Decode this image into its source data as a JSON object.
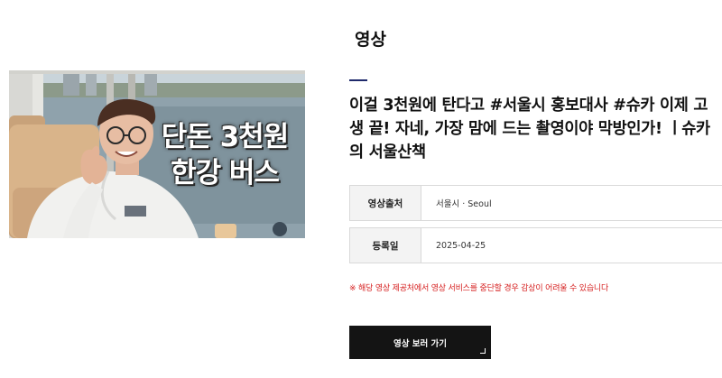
{
  "section": {
    "title": "영상"
  },
  "thumbnail": {
    "overlay_text_line1": "단돈 3천원",
    "overlay_text_line2": "한강 버스"
  },
  "video": {
    "title": "이걸 3천원에 탄다고 #서울시 홍보대사 #슈카 이제 고생 끝! 자네, 가장 맘에 드는 촬영이야 막방인가! ㅣ슈카의 서울산책"
  },
  "info": [
    {
      "label": "영상출처",
      "value": "서울시 · Seoul"
    },
    {
      "label": "등록일",
      "value": "2025-04-25"
    }
  ],
  "notice": "※ 해당 영상 제공처에서 영상 서비스를 중단할 경우 감상이 어려울 수 있습니다",
  "button": {
    "label": "영상 보러 가기",
    "icon": "corner-arrow-icon"
  },
  "colors": {
    "accent": "#1f2a6b",
    "notice": "#d62020",
    "button_bg": "#141414"
  }
}
